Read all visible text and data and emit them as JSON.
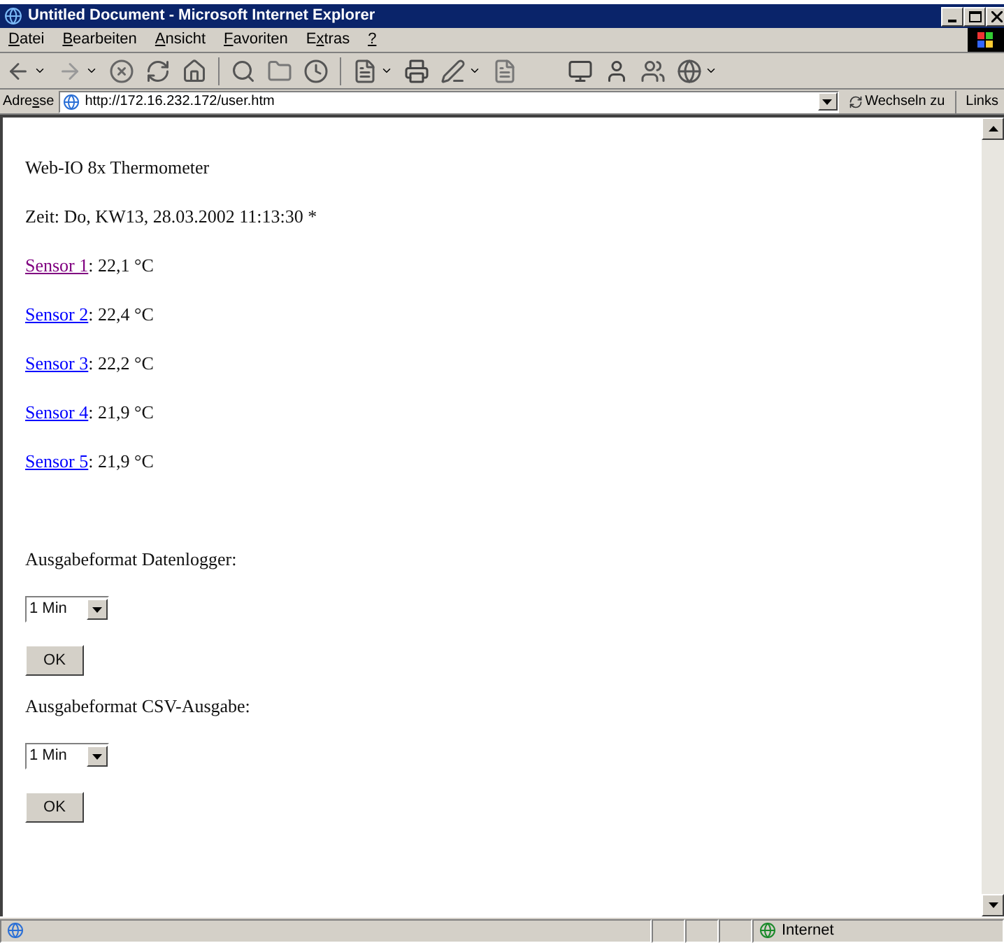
{
  "window": {
    "title": "Untitled Document - Microsoft Internet Explorer"
  },
  "menu": [
    {
      "key": "D",
      "after": "atei"
    },
    {
      "key": "B",
      "after": "earbeiten"
    },
    {
      "key": "A",
      "after": "nsicht"
    },
    {
      "key": "F",
      "after": "avoriten"
    },
    {
      "before": "E",
      "key": "x",
      "after": "tras"
    },
    {
      "key": "?"
    }
  ],
  "address_bar": {
    "label": {
      "before": "Adre",
      "key": "s",
      "after": "se"
    },
    "value": "http://172.16.232.172/user.htm",
    "go_button": "Wechseln zu",
    "links": "Links"
  },
  "page": {
    "heading": "Web-IO 8x Thermometer",
    "time": "Zeit: Do, KW13, 28.03.2002 11:13:30 *",
    "sensors": [
      {
        "link": "Sensor 1",
        "visited": true,
        "reading": ": 22,1 °C"
      },
      {
        "link": "Sensor 2",
        "visited": false,
        "reading": ": 22,4 °C"
      },
      {
        "link": "Sensor 3",
        "visited": false,
        "reading": ": 22,2 °C"
      },
      {
        "link": "Sensor 4",
        "visited": false,
        "reading": ": 21,9 °C"
      },
      {
        "link": "Sensor 5",
        "visited": false,
        "reading": ": 21,9 °C"
      }
    ],
    "forms": [
      {
        "label": "Ausgabeformat Datenlogger:",
        "select": "1 Min",
        "button": "OK"
      },
      {
        "label": "Ausgabeformat CSV-Ausgabe:",
        "select": "1 Min",
        "button": "OK"
      }
    ]
  },
  "status_bar": {
    "zone": "Internet"
  }
}
